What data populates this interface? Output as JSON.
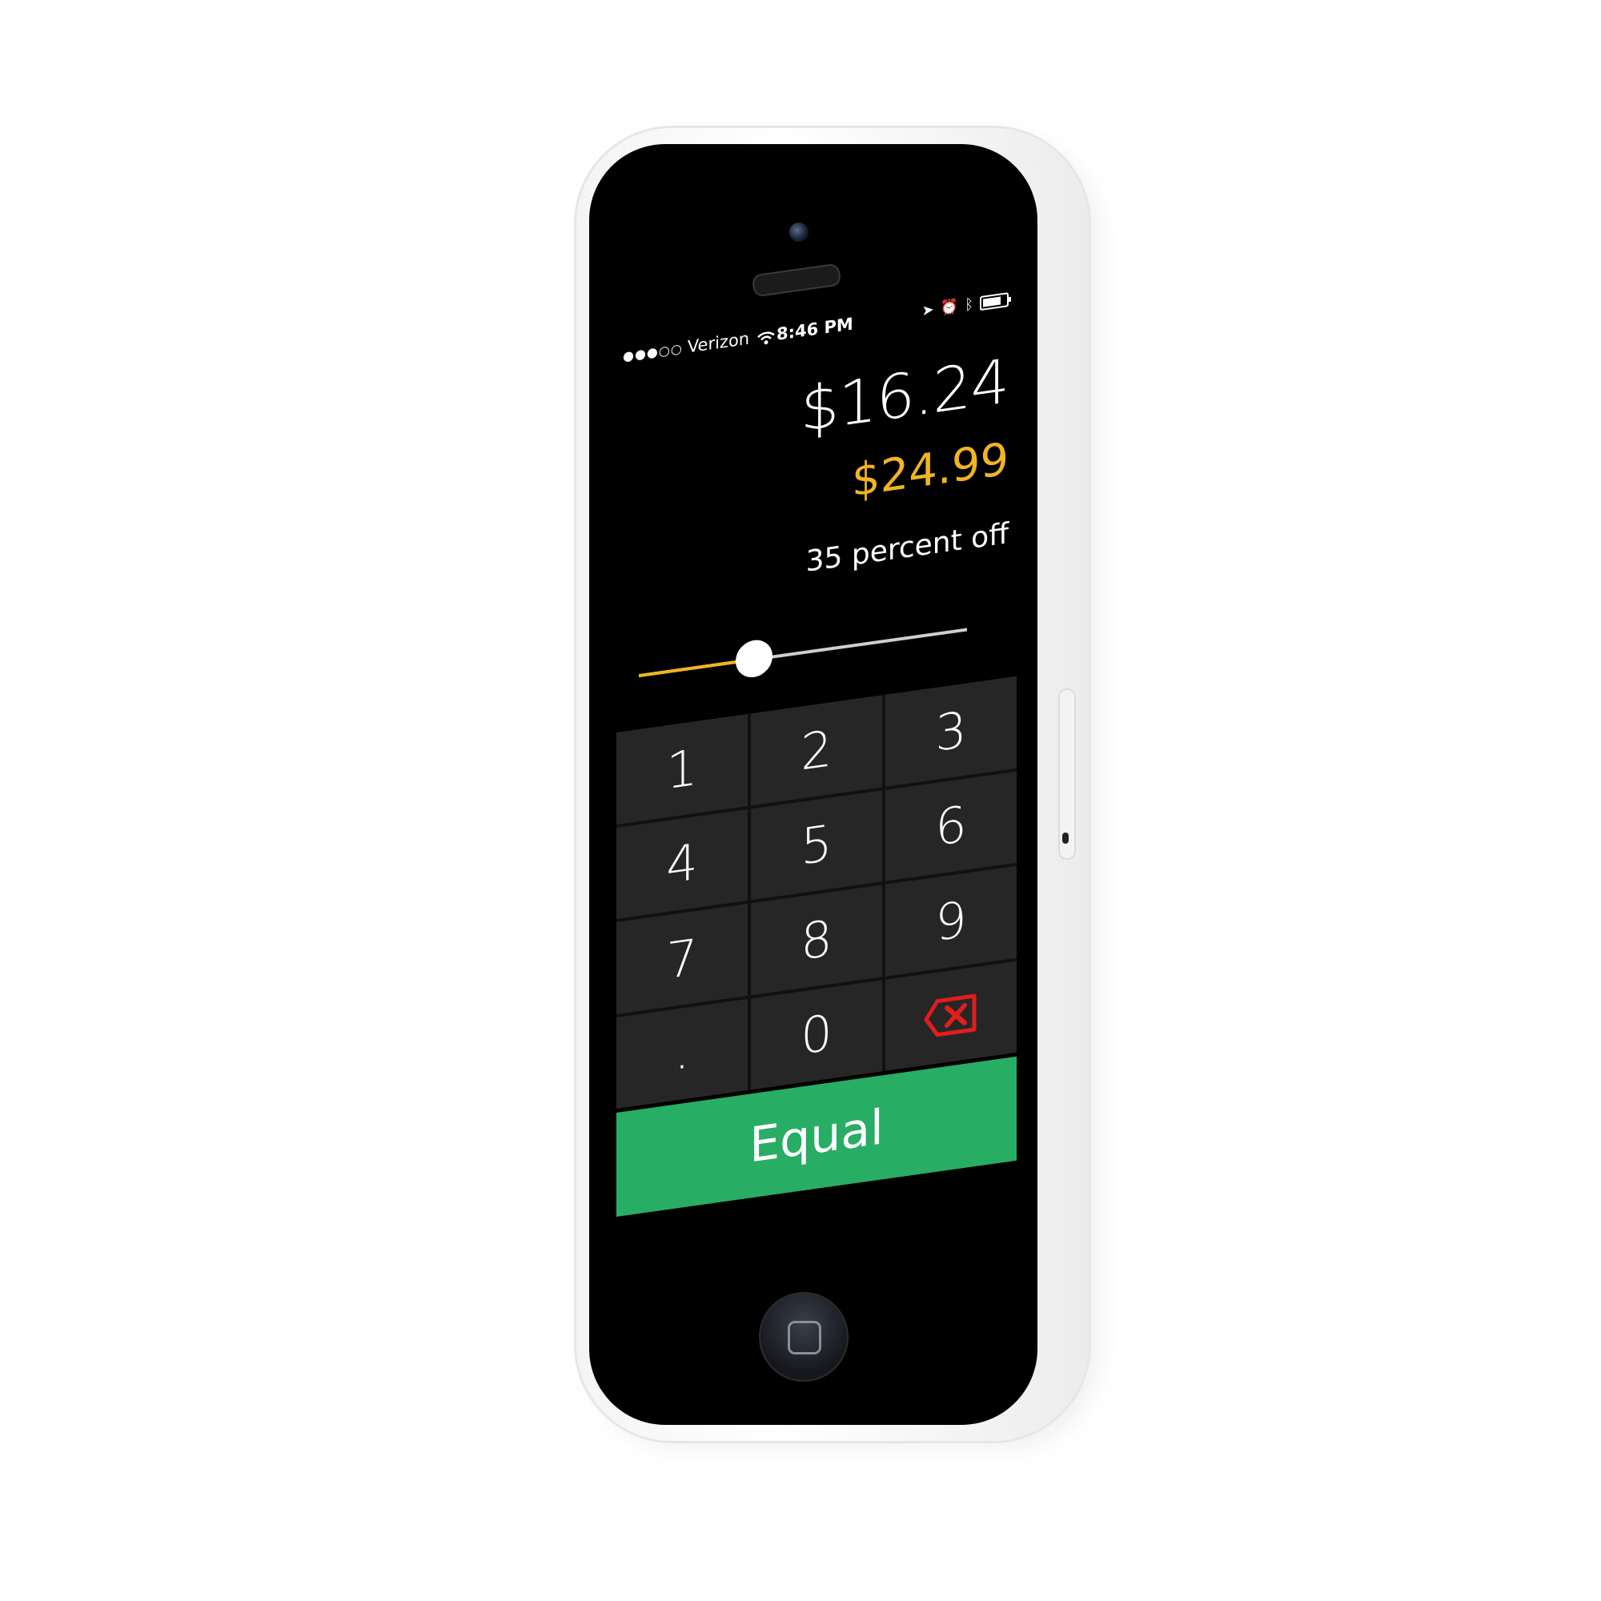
{
  "status_bar": {
    "signal_dots": "●●●○○",
    "carrier": "Verizon",
    "time": "8:46 PM",
    "icons": [
      "wifi-icon",
      "location-arrow-icon",
      "alarm-icon",
      "bluetooth-icon",
      "battery-icon"
    ]
  },
  "calculator": {
    "result": "$16.24",
    "original_price": "$24.99",
    "discount_label": "35 percent off",
    "discount_percent": 35,
    "colors": {
      "accent": "#f1b521",
      "equal": "#28ad64",
      "delete": "#e11d1d",
      "key_background": "#262626"
    }
  },
  "keypad": {
    "keys": [
      "1",
      "2",
      "3",
      "4",
      "5",
      "6",
      "7",
      "8",
      "9",
      ".",
      "0",
      "delete-icon"
    ]
  },
  "equal_button": {
    "label": "Equal"
  }
}
